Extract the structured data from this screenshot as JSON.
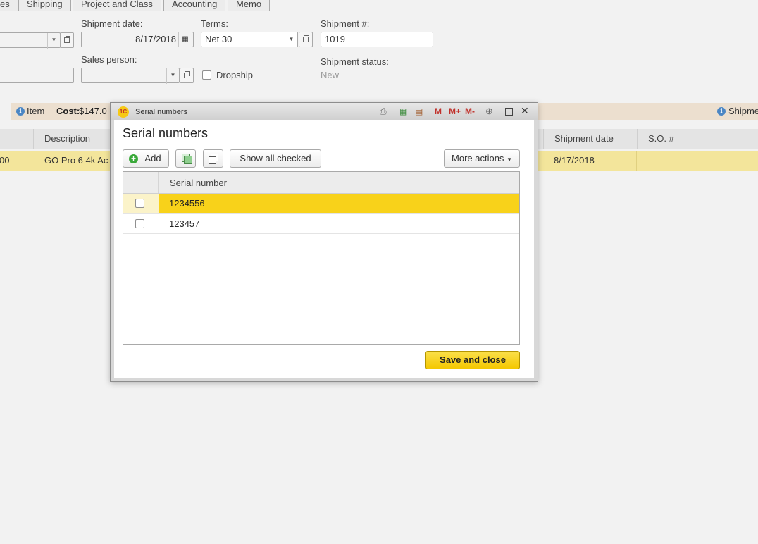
{
  "tabs": [
    "es",
    "Shipping",
    "Project and Class",
    "Accounting",
    "Memo"
  ],
  "form": {
    "shipment_date_label": "Shipment date:",
    "shipment_date_value": "8/17/2018",
    "terms_label": "Terms:",
    "terms_value": "Net 30",
    "shipment_no_label": "Shipment #:",
    "shipment_no_value": "1019",
    "sales_person_label": "Sales person:",
    "sales_person_value": "",
    "dropship_label": "Dropship",
    "shipment_status_label": "Shipment status:",
    "shipment_status_value": "New"
  },
  "itembar": {
    "item_label": "Item",
    "cost_label": "Cost:",
    "cost_value": "$147.0",
    "shipment_link": "Shipme"
  },
  "grid": {
    "columns": [
      "Description",
      "Shipment date",
      "S.O. #"
    ],
    "row": {
      "first_cell": "00",
      "description": "GO Pro 6 4k Ac",
      "shipment_date": "8/17/2018",
      "so_no": ""
    }
  },
  "dialog": {
    "window_title": "Serial numbers",
    "heading": "Serial numbers",
    "add_label": "Add",
    "show_all_checked_label": "Show all checked",
    "more_actions_label": "More actions",
    "column_header": "Serial number",
    "rows": [
      {
        "serial": "1234556",
        "checked": false,
        "selected": true
      },
      {
        "serial": "123457",
        "checked": false,
        "selected": false
      }
    ],
    "save_first_letter": "S",
    "save_rest": "ave and close",
    "toolbar_m": "M",
    "toolbar_mplus": "M+",
    "toolbar_mminus": "M-"
  },
  "colors": {
    "accent": "#f8d21a",
    "row_highlight": "#f3e59b",
    "itembar": "#ecdfcf"
  }
}
